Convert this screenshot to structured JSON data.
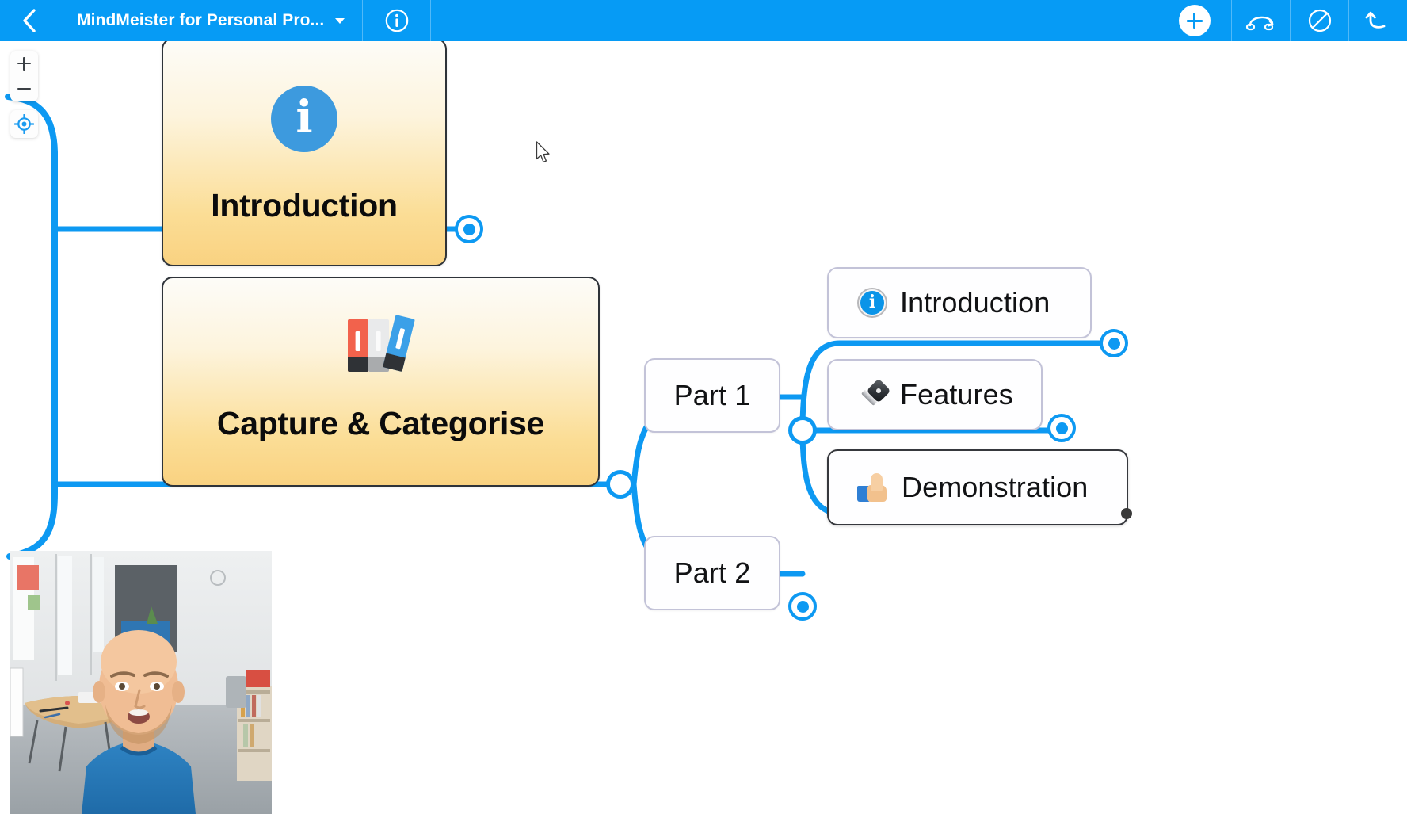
{
  "app": {
    "name": "MindMeister",
    "accent_color": "#069bf5",
    "canvas_background": "#ffffff"
  },
  "topbar": {
    "back_label": "Back",
    "back_icon": "chevron-left-icon",
    "title": "MindMeister for  Personal Pro...",
    "title_caret_icon": "chevron-down-icon",
    "info_icon": "info-circle-icon",
    "add_label": "+",
    "add_icon": "plus-icon",
    "connect_icon": "connection-icon",
    "block_icon": "circle-slash-icon",
    "undo_icon": "undo-arrow-icon"
  },
  "zoom_controls": {
    "zoom_in_icon": "plus-icon",
    "zoom_out_icon": "minus-icon",
    "center_icon": "crosshair-target-icon"
  },
  "mindmap": {
    "nodes": [
      {
        "id": "introduction-main",
        "label": "Introduction",
        "icon": "info-circle-blue-icon",
        "style": "gold",
        "selected": true
      },
      {
        "id": "capture-categorise",
        "label": "Capture & Categorise",
        "icon": "books-binders-emoji",
        "style": "gold",
        "selected": true
      },
      {
        "id": "part-1",
        "label": "Part 1",
        "icon": "",
        "style": "white",
        "selected": false
      },
      {
        "id": "part-2",
        "label": "Part 2",
        "icon": "",
        "style": "white",
        "selected": false
      },
      {
        "id": "sub-introduction",
        "label": "Introduction",
        "icon": "info-emoji",
        "style": "white",
        "selected": false
      },
      {
        "id": "sub-features",
        "label": "Features",
        "icon": "key-emoji",
        "style": "white",
        "selected": false
      },
      {
        "id": "sub-demonstration",
        "label": "Demonstration",
        "icon": "thumbs-up-emoji",
        "style": "white",
        "selected": true
      }
    ],
    "endpoints": [
      {
        "id": "ep-introduction",
        "type": "target"
      },
      {
        "id": "ep-capture",
        "type": "hollow"
      },
      {
        "id": "ep-part1-junction",
        "type": "hollow"
      },
      {
        "id": "ep-part2",
        "type": "target"
      },
      {
        "id": "ep-sub-introduction",
        "type": "target"
      },
      {
        "id": "ep-sub-features",
        "type": "target"
      },
      {
        "id": "ep-sub-demonstration",
        "type": "dark-dot"
      }
    ],
    "connector_color": "#0d99f2"
  },
  "webcam": {
    "label": "presenter-video-overlay"
  },
  "cursor": {
    "icon": "arrow-pointer"
  }
}
